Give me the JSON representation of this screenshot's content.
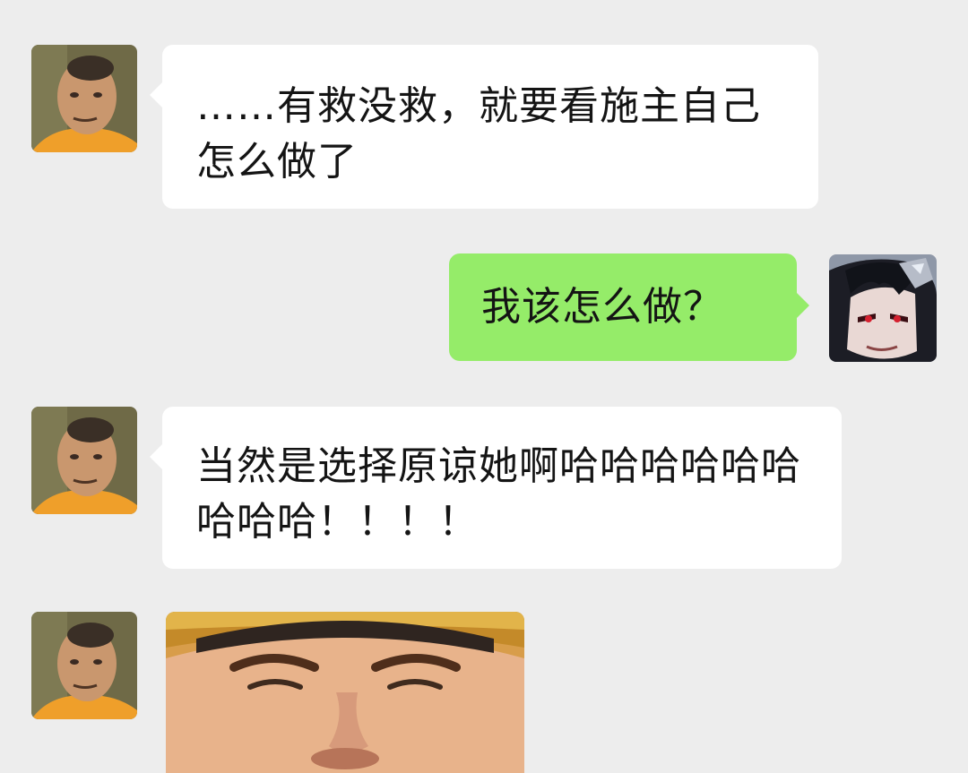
{
  "messages": [
    {
      "side": "left",
      "avatar": "monk-avatar",
      "text": "……有救没救，就要看施主自己怎么做了"
    },
    {
      "side": "right",
      "avatar": "anime-avatar",
      "text": "我该怎么做？"
    },
    {
      "side": "left",
      "avatar": "monk-avatar",
      "text": "当然是选择原谅她啊哈哈哈哈哈哈哈哈哈！！！！"
    },
    {
      "side": "left",
      "avatar": "monk-avatar",
      "image": "laughing-face-sticker"
    }
  ],
  "colors": {
    "background": "#ededed",
    "incoming_bubble": "#ffffff",
    "outgoing_bubble": "#95ec69",
    "text": "#141414"
  }
}
